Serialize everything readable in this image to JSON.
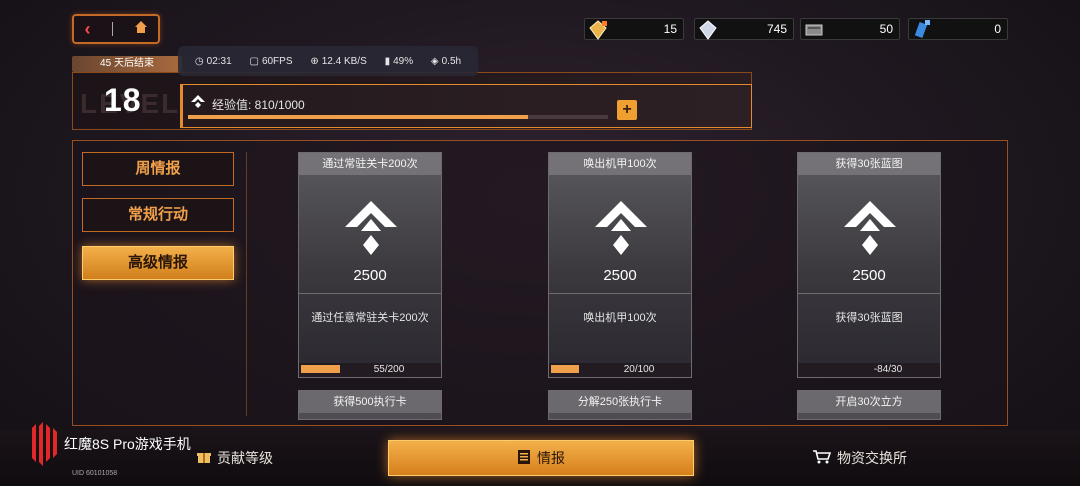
{
  "nav": {
    "back_icon": "back-arrow-icon",
    "home_icon": "home-icon"
  },
  "resources": [
    {
      "icon": "gem-icon",
      "value": "15",
      "color": "#e9b24a"
    },
    {
      "icon": "crystal-icon",
      "value": "745",
      "color": "#cfd8e6"
    },
    {
      "icon": "module-icon",
      "value": "50",
      "color": "#9a9a9a"
    },
    {
      "icon": "blue-ticket-icon",
      "value": "0",
      "color": "#3a8ae0"
    }
  ],
  "perf": {
    "time": "02:31",
    "fps": "60FPS",
    "net": "12.4 KB/S",
    "battery": "49%",
    "duration": "0.5h"
  },
  "event": {
    "days_left": "45 天后结束"
  },
  "level": {
    "number": "18",
    "bg_text": "LEVEL",
    "exp_label": "经验值: 810/1000",
    "exp_fraction": 0.81,
    "plus_label": "+"
  },
  "sidebar": {
    "items": [
      {
        "label": "周情报",
        "active": false
      },
      {
        "label": "常规行动",
        "active": false
      },
      {
        "label": "高级情报",
        "active": true
      }
    ]
  },
  "cards": [
    {
      "title": "通过常驻关卡200次",
      "points": "2500",
      "desc": "通过任意常驻关卡200次",
      "progress": "55/200",
      "fraction": 0.275
    },
    {
      "title": "唤出机甲100次",
      "points": "2500",
      "desc": "唤出机甲100次",
      "progress": "20/100",
      "fraction": 0.2
    },
    {
      "title": "获得30张蓝图",
      "points": "2500",
      "desc": "获得30张蓝图",
      "progress": "-84/30",
      "fraction": 0
    }
  ],
  "cards_next": [
    {
      "title": "获得500执行卡"
    },
    {
      "title": "分解250张执行卡"
    },
    {
      "title": "开启30次立方"
    }
  ],
  "bottom_tabs": [
    {
      "label": "贡献等级",
      "icon": "gift-icon",
      "active": false
    },
    {
      "label": "情报",
      "icon": "document-icon",
      "active": true
    },
    {
      "label": "物资交换所",
      "icon": "cart-icon",
      "active": false
    }
  ],
  "watermark": {
    "text": "红魔8S Pro游戏手机",
    "uid": "UID 60101058"
  }
}
